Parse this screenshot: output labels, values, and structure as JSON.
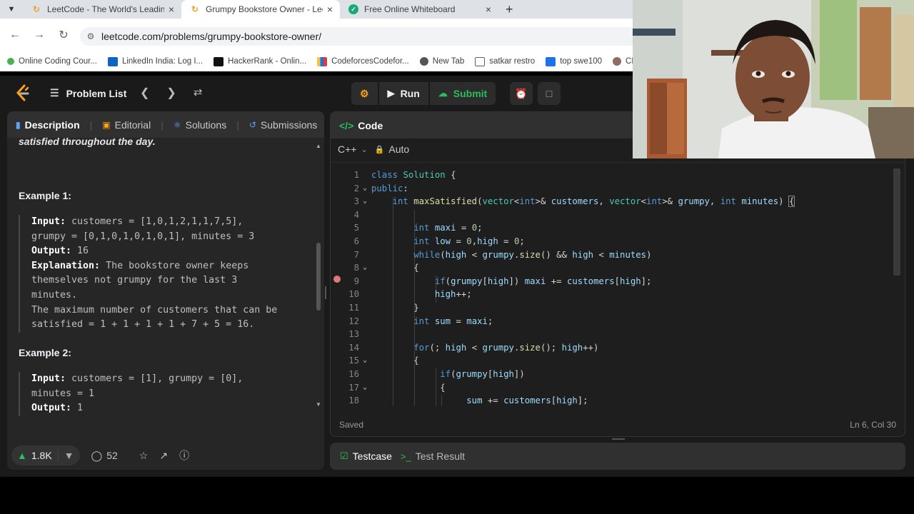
{
  "browser": {
    "tabs": [
      {
        "title": "LeetCode - The World's Leading",
        "active": false
      },
      {
        "title": "Grumpy Bookstore Owner - LeetCode",
        "active": true
      },
      {
        "title": "Free Online Whiteboard",
        "active": false
      }
    ],
    "url": "leetcode.com/problems/grumpy-bookstore-owner/",
    "bookmarks": [
      "Online Coding Cour...",
      "LinkedIn India: Log I...",
      "HackerRank - Onlin...",
      "CodeforcesCodefor...",
      "New Tab",
      "satkar restro",
      "top swe100",
      "CP"
    ]
  },
  "toolbar": {
    "problem_list": "Problem List",
    "run": "Run",
    "submit": "Submit"
  },
  "left_panel": {
    "tabs": [
      "Description",
      "Editorial",
      "Solutions",
      "Submissions"
    ],
    "intro_tail": "satisfied throughout the day.",
    "example1": {
      "heading": "Example 1:",
      "input_label": "Input:",
      "input_line1": " customers = [1,0,1,2,1,1,7,5],",
      "input_line2": "grumpy = [0,1,0,1,0,1,0,1], minutes = 3",
      "output_label": "Output:",
      "output_value": " 16",
      "explanation_label": "Explanation:",
      "explanation_line1": " The bookstore owner keeps",
      "explanation_line2": "themselves not grumpy for the last 3",
      "explanation_line3": "minutes.",
      "explanation_line4": "The maximum number of customers that can be",
      "explanation_line5": "satisfied = 1 + 1 + 1 + 1 + 7 + 5 = 16."
    },
    "example2": {
      "heading": "Example 2:",
      "input_label": "Input:",
      "input_line1": " customers = [1], grumpy = [0],",
      "input_line2": "minutes = 1",
      "output_label": "Output:",
      "output_value": " 1"
    },
    "footer": {
      "likes": "1.8K",
      "comments": "52"
    }
  },
  "code_panel": {
    "title": "Code",
    "language": "C++",
    "mode": "Auto",
    "status": "Saved",
    "cursor_position": "Ln 6, Col 30",
    "line_numbers": [
      "1",
      "2",
      "3",
      "4",
      "5",
      "6",
      "7",
      "8",
      "9",
      "10",
      "11",
      "12",
      "13",
      "14",
      "15",
      "16",
      "17",
      "18"
    ]
  },
  "test_panel": {
    "testcase": "Testcase",
    "result": "Test Result"
  },
  "colors": {
    "accent": "#ffa116",
    "submit_green": "#2cbb5d",
    "keyword_blue": "#569cd6",
    "function_yellow": "#dcdcaa"
  }
}
